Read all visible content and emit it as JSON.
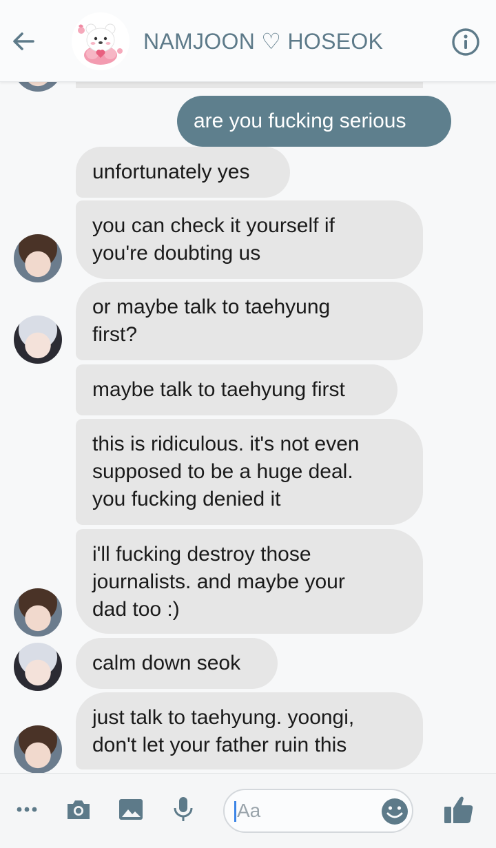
{
  "header": {
    "title": "NAMJOON ♡ HOSEOK"
  },
  "messages": [
    {
      "id": 1,
      "direction": "outgoing",
      "text": "are you fucking serious"
    },
    {
      "id": 2,
      "direction": "incoming",
      "text": "unfortunately yes"
    },
    {
      "id": 3,
      "direction": "incoming",
      "text": "you can check it yourself if\nyou're doubting us"
    },
    {
      "id": 4,
      "direction": "incoming",
      "text": "or maybe talk to taehyung\nfirst?"
    },
    {
      "id": 5,
      "direction": "incoming",
      "text": "maybe talk to taehyung first"
    },
    {
      "id": 6,
      "direction": "incoming",
      "text": "this is ridiculous. it's not even\nsupposed to be a huge deal.\nyou fucking denied it"
    },
    {
      "id": 7,
      "direction": "incoming",
      "text": "i'll fucking destroy those\njournalists. and maybe your\ndad too :)"
    },
    {
      "id": 8,
      "direction": "incoming",
      "text": "calm down seok"
    },
    {
      "id": 9,
      "direction": "incoming",
      "text": "just talk to taehyung. yoongi,\ndon't let your father ruin this"
    }
  ],
  "composer": {
    "placeholder": "Aa",
    "icons": [
      "more-icon",
      "camera-icon",
      "image-icon",
      "microphone-icon",
      "emoji-icon",
      "thumbs-up-icon"
    ]
  },
  "colors": {
    "accent": "#5e7f8d",
    "incoming_bubble": "#e6e6e6",
    "background": "#f7f8f9"
  }
}
